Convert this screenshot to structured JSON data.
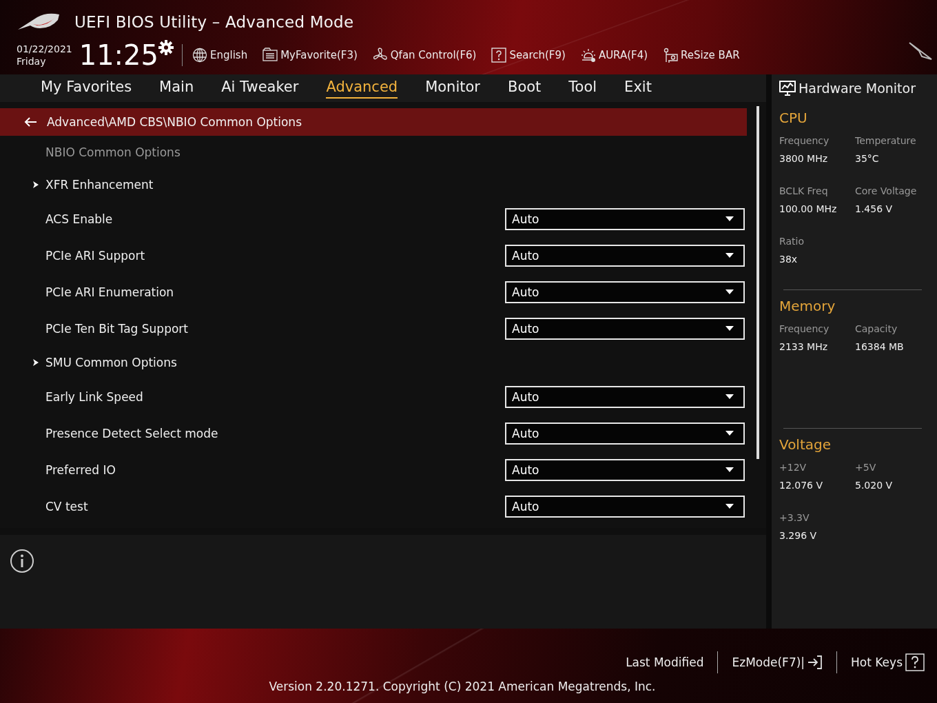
{
  "window": {
    "title": "UEFI BIOS Utility – Advanced Mode"
  },
  "clock": {
    "date": "01/22/2021",
    "day": "Friday",
    "time": "11:25"
  },
  "toolbar": [
    {
      "label": "English"
    },
    {
      "label": "MyFavorite(F3)"
    },
    {
      "label": "Qfan Control(F6)"
    },
    {
      "label": "Search(F9)"
    },
    {
      "label": "AURA(F4)"
    },
    {
      "label": "ReSize BAR"
    }
  ],
  "tabs": [
    {
      "label": "My Favorites",
      "selected": false
    },
    {
      "label": "Main",
      "selected": false
    },
    {
      "label": "Ai Tweaker",
      "selected": false
    },
    {
      "label": "Advanced",
      "selected": true
    },
    {
      "label": "Monitor",
      "selected": false
    },
    {
      "label": "Boot",
      "selected": false
    },
    {
      "label": "Tool",
      "selected": false
    },
    {
      "label": "Exit",
      "selected": false
    }
  ],
  "breadcrumb": "Advanced\\AMD CBS\\NBIO Common Options",
  "items": [
    {
      "kind": "heading",
      "label": "NBIO Common Options"
    },
    {
      "kind": "submenu",
      "label": "XFR Enhancement"
    },
    {
      "kind": "setting",
      "label": "ACS Enable",
      "value": "Auto"
    },
    {
      "kind": "setting",
      "label": "PCIe ARI Support",
      "value": "Auto"
    },
    {
      "kind": "setting",
      "label": "PCIe ARI Enumeration",
      "value": "Auto"
    },
    {
      "kind": "setting",
      "label": "PCIe Ten Bit Tag Support",
      "value": "Auto"
    },
    {
      "kind": "submenu",
      "label": "SMU Common Options"
    },
    {
      "kind": "setting",
      "label": "Early Link Speed",
      "value": "Auto"
    },
    {
      "kind": "setting",
      "label": "Presence Detect Select mode",
      "value": "Auto"
    },
    {
      "kind": "setting",
      "label": "Preferred IO",
      "value": "Auto"
    },
    {
      "kind": "setting",
      "label": "CV test",
      "value": "Auto"
    }
  ],
  "hardware_monitor": {
    "title": "Hardware Monitor",
    "sections": [
      {
        "title": "CPU",
        "readings": [
          {
            "label": "Frequency",
            "value": "3800 MHz"
          },
          {
            "label": "Temperature",
            "value": "35°C"
          },
          {
            "label": "BCLK Freq",
            "value": "100.00 MHz"
          },
          {
            "label": "Core Voltage",
            "value": "1.456 V"
          },
          {
            "label": "Ratio",
            "value": "38x"
          }
        ]
      },
      {
        "title": "Memory",
        "readings": [
          {
            "label": "Frequency",
            "value": "2133 MHz"
          },
          {
            "label": "Capacity",
            "value": "16384 MB"
          }
        ]
      },
      {
        "title": "Voltage",
        "readings": [
          {
            "label": "+12V",
            "value": "12.076 V"
          },
          {
            "label": "+5V",
            "value": "5.020 V"
          },
          {
            "label": "+3.3V",
            "value": "3.296 V"
          }
        ]
      }
    ]
  },
  "footer": {
    "buttons": [
      {
        "label": "Last Modified"
      },
      {
        "label": "EzMode(F7)|"
      },
      {
        "label": "Hot Keys"
      }
    ],
    "version": "Version 2.20.1271. Copyright (C) 2021 American Megatrends, Inc."
  }
}
